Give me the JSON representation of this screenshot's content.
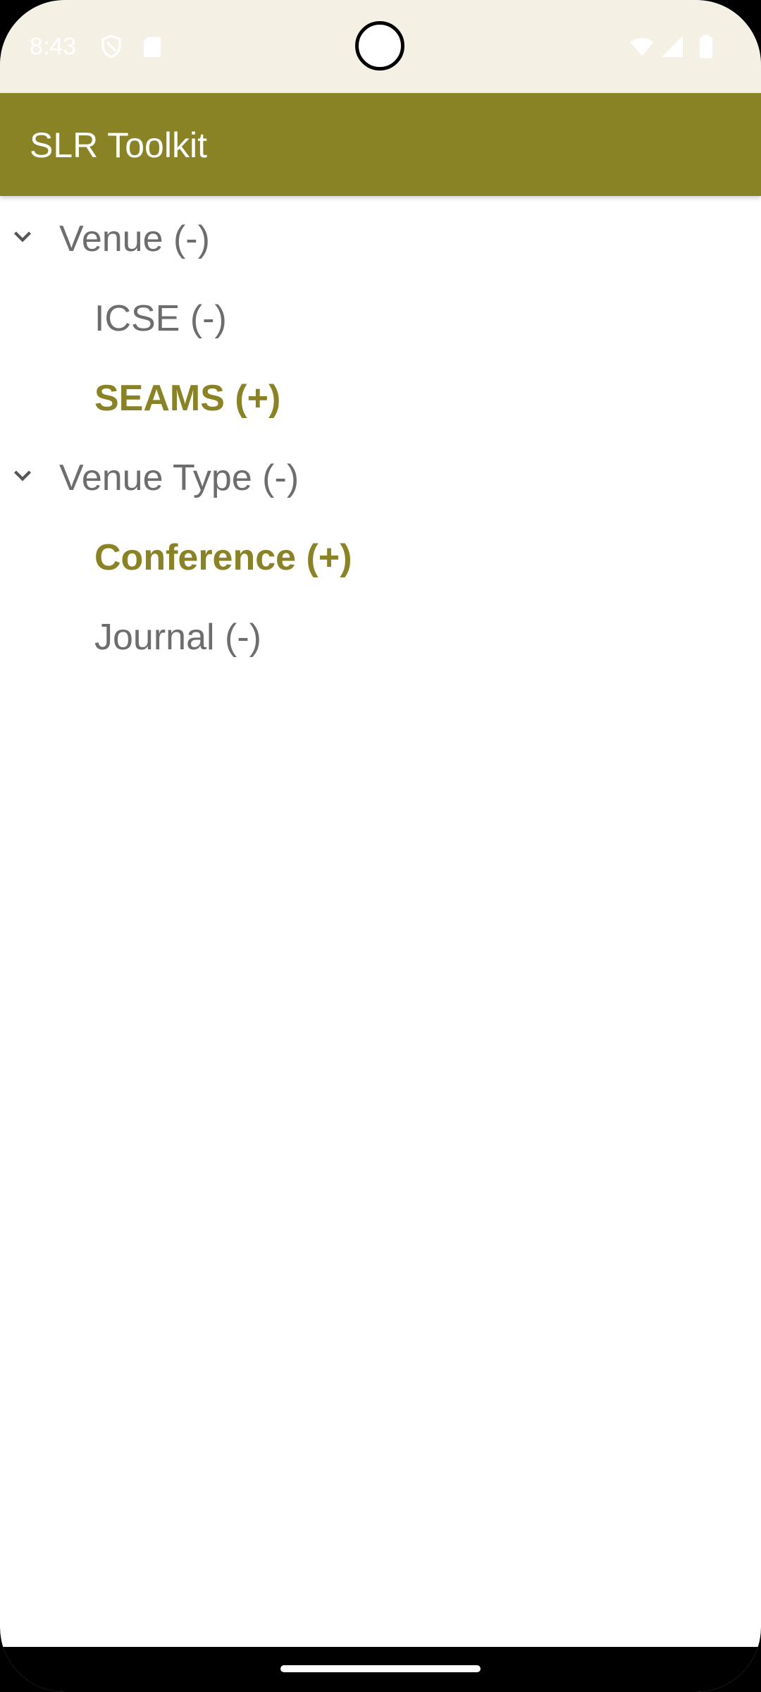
{
  "status_bar": {
    "time": "8:43",
    "icons": [
      "shield-icon",
      "sd-card-icon",
      "wifi-icon",
      "signal-icon",
      "battery-icon"
    ],
    "icon_color": "#ffffff",
    "background": "#f4f0e4"
  },
  "app_bar": {
    "title": "SLR Toolkit",
    "color": "#8a8326"
  },
  "tree": {
    "groups": [
      {
        "label": "Venue (-)",
        "expanded": true,
        "children": [
          {
            "label": "ICSE (-)",
            "selected": false
          },
          {
            "label": "SEAMS (+)",
            "selected": true
          }
        ]
      },
      {
        "label": "Venue Type (-)",
        "expanded": true,
        "children": [
          {
            "label": "Conference (+)",
            "selected": true
          },
          {
            "label": "Journal (-)",
            "selected": false
          }
        ]
      }
    ],
    "text_color": "#6d6d6d",
    "selected_color": "#8a8326"
  }
}
